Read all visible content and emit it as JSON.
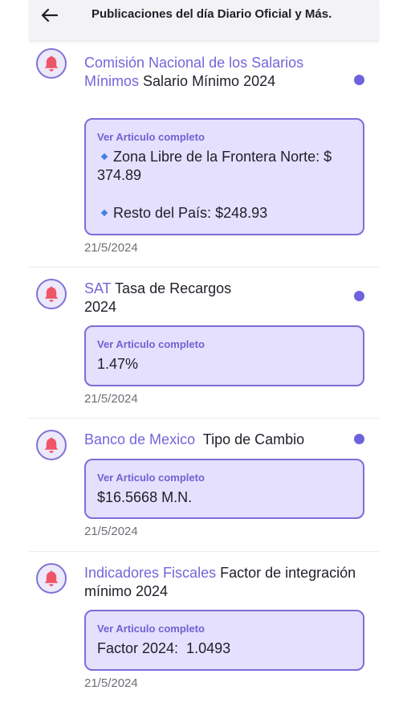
{
  "header": {
    "title": "Publicaciones del día Diario Oficial y Más."
  },
  "card_label": "Ver Articulo completo",
  "items": [
    {
      "source": "Comisión Nacional de los Salarios Mínimos",
      "title": "Salario Mínimo 2024",
      "unread": true,
      "bullets": [
        "Zona Libre de la Frontera Norte: $ 374.89",
        "Resto del País: $248.93"
      ],
      "date": "21/5/2024"
    },
    {
      "source": "SAT",
      "title": "Tasa de Recargos 2024",
      "unread": true,
      "value": "1.47%",
      "date": "21/5/2024"
    },
    {
      "source": "Banco de Mexico",
      "title": "Tipo de Cambio",
      "unread": true,
      "value": "$16.5668 M.N.",
      "date": "21/5/2024"
    },
    {
      "source": "Indicadores Fiscales",
      "title": "Factor de integración mínimo 2024",
      "unread": false,
      "value": "Factor 2024:  1.0493",
      "date": "21/5/2024"
    }
  ],
  "colors": {
    "accent": "#7166d9",
    "card_bg": "#e4e0fd",
    "bell": "#ee5566",
    "unread_dot": "#6f62dd"
  },
  "icons": {
    "back": "arrow-left-icon",
    "notification": "bell-icon",
    "bullet": "small-blue-diamond"
  }
}
